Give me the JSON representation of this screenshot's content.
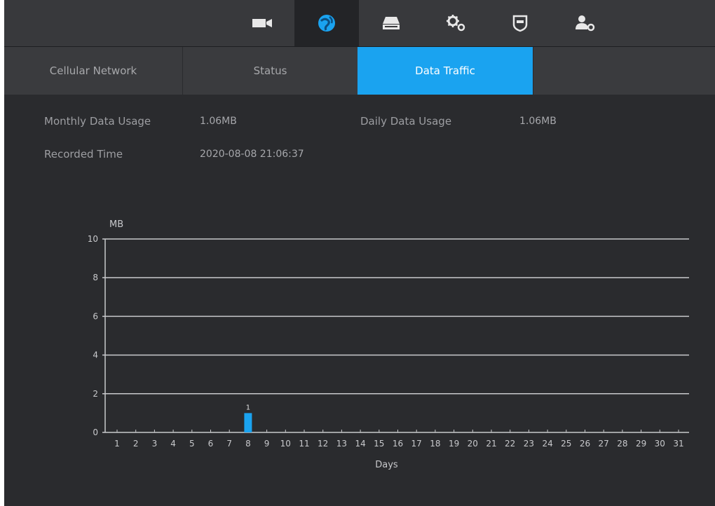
{
  "topbar": {
    "icons": [
      {
        "name": "camera-icon",
        "active": false
      },
      {
        "name": "network-icon",
        "active": true
      },
      {
        "name": "storage-icon",
        "active": false
      },
      {
        "name": "system-settings-icon",
        "active": false
      },
      {
        "name": "security-icon",
        "active": false
      },
      {
        "name": "account-icon",
        "active": false
      }
    ]
  },
  "tabs": [
    {
      "label": "Cellular Network",
      "active": false
    },
    {
      "label": "Status",
      "active": false
    },
    {
      "label": "Data Traffic",
      "active": true
    }
  ],
  "info": {
    "monthly_label": "Monthly Data Usage",
    "monthly_value": "1.06MB",
    "daily_label": "Daily Data Usage",
    "daily_value": "1.06MB",
    "recorded_label": "Recorded Time",
    "recorded_value": "2020-08-08 21:06:37"
  },
  "colors": {
    "accent": "#1aa3f0",
    "bar": "#1aa3f0",
    "gridline": "#c8c9cc"
  },
  "chart_data": {
    "type": "bar",
    "ylabel": "MB",
    "xlabel": "Days",
    "ylim": [
      0,
      10
    ],
    "yticks": [
      0,
      2,
      4,
      6,
      8,
      10
    ],
    "grid": true,
    "categories": [
      "1",
      "2",
      "3",
      "4",
      "5",
      "6",
      "7",
      "8",
      "9",
      "10",
      "11",
      "12",
      "13",
      "14",
      "15",
      "16",
      "17",
      "18",
      "19",
      "20",
      "21",
      "22",
      "23",
      "24",
      "25",
      "26",
      "27",
      "28",
      "29",
      "30",
      "31"
    ],
    "values": [
      0,
      0,
      0,
      0,
      0,
      0,
      0,
      1,
      0,
      0,
      0,
      0,
      0,
      0,
      0,
      0,
      0,
      0,
      0,
      0,
      0,
      0,
      0,
      0,
      0,
      0,
      0,
      0,
      0,
      0,
      0
    ],
    "data_labels": {
      "8": "1"
    }
  }
}
